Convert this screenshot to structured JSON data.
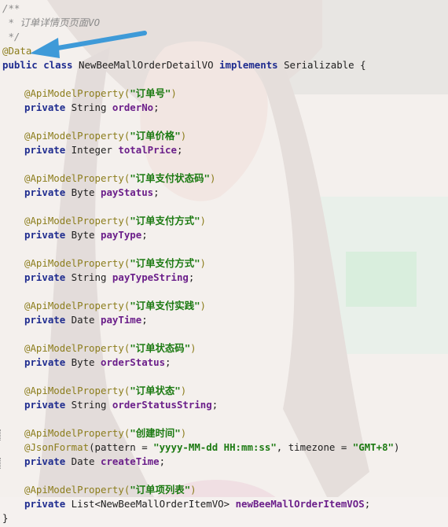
{
  "editor": {
    "doc_open": "/**",
    "doc_line": " * 订单详情页页面VO",
    "doc_close": " */",
    "class_annotation": "@Data",
    "class_decl": {
      "kw1": "public class",
      "name": " NewBeeMallOrderDetailVO ",
      "kw2": "implements",
      "rest": " Serializable {"
    },
    "fields": [
      {
        "anno": "@ApiModelProperty(",
        "desc": "\"订单号\"",
        "close": ")",
        "mod": "private",
        "type": " String ",
        "name": "orderNo",
        "end": ";"
      },
      {
        "anno": "@ApiModelProperty(",
        "desc": "\"订单价格\"",
        "close": ")",
        "mod": "private",
        "type": " Integer ",
        "name": "totalPrice",
        "end": ";"
      },
      {
        "anno": "@ApiModelProperty(",
        "desc": "\"订单支付状态码\"",
        "close": ")",
        "mod": "private",
        "type": " Byte ",
        "name": "payStatus",
        "end": ";"
      },
      {
        "anno": "@ApiModelProperty(",
        "desc": "\"订单支付方式\"",
        "close": ")",
        "mod": "private",
        "type": " Byte ",
        "name": "payType",
        "end": ";"
      },
      {
        "anno": "@ApiModelProperty(",
        "desc": "\"订单支付方式\"",
        "close": ")",
        "mod": "private",
        "type": " String ",
        "name": "payTypeString",
        "end": ";"
      },
      {
        "anno": "@ApiModelProperty(",
        "desc": "\"订单支付实践\"",
        "close": ")",
        "mod": "private",
        "type": " Date ",
        "name": "payTime",
        "end": ";"
      },
      {
        "anno": "@ApiModelProperty(",
        "desc": "\"订单状态码\"",
        "close": ")",
        "mod": "private",
        "type": " Byte ",
        "name": "orderStatus",
        "end": ";"
      },
      {
        "anno": "@ApiModelProperty(",
        "desc": "\"订单状态\"",
        "close": ")",
        "mod": "private",
        "type": " String ",
        "name": "orderStatusString",
        "end": ";"
      },
      {
        "anno": "@ApiModelProperty(",
        "desc": "\"创建时间\"",
        "close": ")",
        "mod": "private",
        "type": " Date ",
        "name": "createTime",
        "end": ";"
      },
      {
        "anno": "@ApiModelProperty(",
        "desc": "\"订单项列表\"",
        "close": ")",
        "mod": "private",
        "type": " List<NewBeeMallOrderItemVO> ",
        "name": "newBeeMallOrderItemVOS",
        "end": ";"
      }
    ],
    "json_format": {
      "anno": "@JsonFormat",
      "open": "(pattern = ",
      "pattern": "\"yyyy-MM-dd HH:mm:ss\"",
      "mid": ", timezone = ",
      "tz": "\"GMT+8\"",
      "close": ")"
    },
    "closing_brace": "}"
  },
  "colors": {
    "comment": "#8a8a8a",
    "annotation": "#8c7d1c",
    "keyword": "#1f2c8f",
    "string": "#1c7a12",
    "field": "#6b1f8a",
    "arrow": "#3e9ad8"
  },
  "icons": {
    "arrow": "pointer-arrow-icon"
  }
}
